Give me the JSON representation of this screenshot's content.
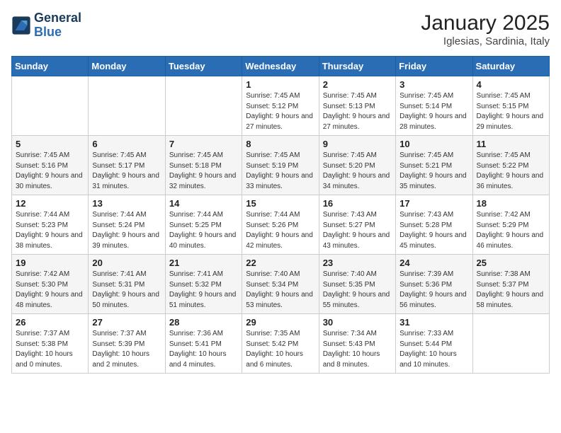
{
  "header": {
    "logo_line1": "General",
    "logo_line2": "Blue",
    "month_year": "January 2025",
    "location": "Iglesias, Sardinia, Italy"
  },
  "weekdays": [
    "Sunday",
    "Monday",
    "Tuesday",
    "Wednesday",
    "Thursday",
    "Friday",
    "Saturday"
  ],
  "weeks": [
    [
      {
        "day": "",
        "info": ""
      },
      {
        "day": "",
        "info": ""
      },
      {
        "day": "",
        "info": ""
      },
      {
        "day": "1",
        "info": "Sunrise: 7:45 AM\nSunset: 5:12 PM\nDaylight: 9 hours and 27 minutes."
      },
      {
        "day": "2",
        "info": "Sunrise: 7:45 AM\nSunset: 5:13 PM\nDaylight: 9 hours and 27 minutes."
      },
      {
        "day": "3",
        "info": "Sunrise: 7:45 AM\nSunset: 5:14 PM\nDaylight: 9 hours and 28 minutes."
      },
      {
        "day": "4",
        "info": "Sunrise: 7:45 AM\nSunset: 5:15 PM\nDaylight: 9 hours and 29 minutes."
      }
    ],
    [
      {
        "day": "5",
        "info": "Sunrise: 7:45 AM\nSunset: 5:16 PM\nDaylight: 9 hours and 30 minutes."
      },
      {
        "day": "6",
        "info": "Sunrise: 7:45 AM\nSunset: 5:17 PM\nDaylight: 9 hours and 31 minutes."
      },
      {
        "day": "7",
        "info": "Sunrise: 7:45 AM\nSunset: 5:18 PM\nDaylight: 9 hours and 32 minutes."
      },
      {
        "day": "8",
        "info": "Sunrise: 7:45 AM\nSunset: 5:19 PM\nDaylight: 9 hours and 33 minutes."
      },
      {
        "day": "9",
        "info": "Sunrise: 7:45 AM\nSunset: 5:20 PM\nDaylight: 9 hours and 34 minutes."
      },
      {
        "day": "10",
        "info": "Sunrise: 7:45 AM\nSunset: 5:21 PM\nDaylight: 9 hours and 35 minutes."
      },
      {
        "day": "11",
        "info": "Sunrise: 7:45 AM\nSunset: 5:22 PM\nDaylight: 9 hours and 36 minutes."
      }
    ],
    [
      {
        "day": "12",
        "info": "Sunrise: 7:44 AM\nSunset: 5:23 PM\nDaylight: 9 hours and 38 minutes."
      },
      {
        "day": "13",
        "info": "Sunrise: 7:44 AM\nSunset: 5:24 PM\nDaylight: 9 hours and 39 minutes."
      },
      {
        "day": "14",
        "info": "Sunrise: 7:44 AM\nSunset: 5:25 PM\nDaylight: 9 hours and 40 minutes."
      },
      {
        "day": "15",
        "info": "Sunrise: 7:44 AM\nSunset: 5:26 PM\nDaylight: 9 hours and 42 minutes."
      },
      {
        "day": "16",
        "info": "Sunrise: 7:43 AM\nSunset: 5:27 PM\nDaylight: 9 hours and 43 minutes."
      },
      {
        "day": "17",
        "info": "Sunrise: 7:43 AM\nSunset: 5:28 PM\nDaylight: 9 hours and 45 minutes."
      },
      {
        "day": "18",
        "info": "Sunrise: 7:42 AM\nSunset: 5:29 PM\nDaylight: 9 hours and 46 minutes."
      }
    ],
    [
      {
        "day": "19",
        "info": "Sunrise: 7:42 AM\nSunset: 5:30 PM\nDaylight: 9 hours and 48 minutes."
      },
      {
        "day": "20",
        "info": "Sunrise: 7:41 AM\nSunset: 5:31 PM\nDaylight: 9 hours and 50 minutes."
      },
      {
        "day": "21",
        "info": "Sunrise: 7:41 AM\nSunset: 5:32 PM\nDaylight: 9 hours and 51 minutes."
      },
      {
        "day": "22",
        "info": "Sunrise: 7:40 AM\nSunset: 5:34 PM\nDaylight: 9 hours and 53 minutes."
      },
      {
        "day": "23",
        "info": "Sunrise: 7:40 AM\nSunset: 5:35 PM\nDaylight: 9 hours and 55 minutes."
      },
      {
        "day": "24",
        "info": "Sunrise: 7:39 AM\nSunset: 5:36 PM\nDaylight: 9 hours and 56 minutes."
      },
      {
        "day": "25",
        "info": "Sunrise: 7:38 AM\nSunset: 5:37 PM\nDaylight: 9 hours and 58 minutes."
      }
    ],
    [
      {
        "day": "26",
        "info": "Sunrise: 7:37 AM\nSunset: 5:38 PM\nDaylight: 10 hours and 0 minutes."
      },
      {
        "day": "27",
        "info": "Sunrise: 7:37 AM\nSunset: 5:39 PM\nDaylight: 10 hours and 2 minutes."
      },
      {
        "day": "28",
        "info": "Sunrise: 7:36 AM\nSunset: 5:41 PM\nDaylight: 10 hours and 4 minutes."
      },
      {
        "day": "29",
        "info": "Sunrise: 7:35 AM\nSunset: 5:42 PM\nDaylight: 10 hours and 6 minutes."
      },
      {
        "day": "30",
        "info": "Sunrise: 7:34 AM\nSunset: 5:43 PM\nDaylight: 10 hours and 8 minutes."
      },
      {
        "day": "31",
        "info": "Sunrise: 7:33 AM\nSunset: 5:44 PM\nDaylight: 10 hours and 10 minutes."
      },
      {
        "day": "",
        "info": ""
      }
    ]
  ]
}
